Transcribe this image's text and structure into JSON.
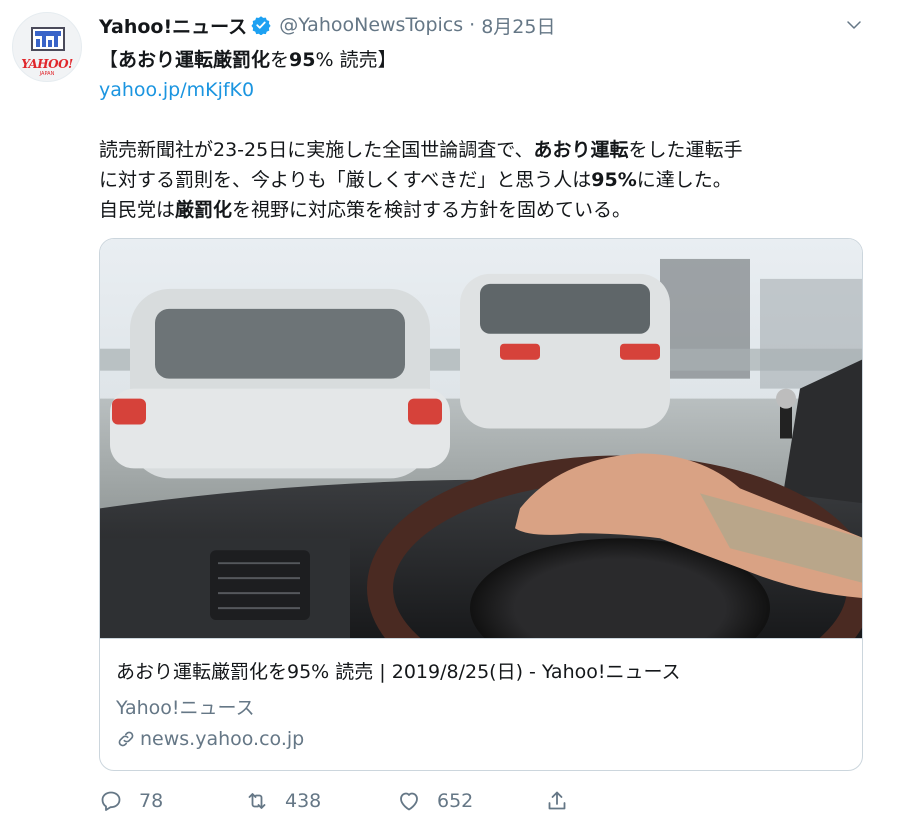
{
  "tweet": {
    "display_name": "Yahoo!ニュース",
    "handle": "@YahooNewsTopics",
    "separator": "·",
    "date": "8月25日",
    "avatar": {
      "icon": "yahoo-news-logo",
      "logo_text": "YAHOO!",
      "logo_subtext": "JAPAN"
    },
    "verified_icon": "verified-badge-icon",
    "headline": {
      "open_bracket": "【",
      "bold1": "あおり運転厳罰化",
      "plain1": "を",
      "bold2": "95",
      "plain2": "% 読売】"
    },
    "short_link": "yahoo.jp/mKjfK0",
    "body": {
      "line1_a": "読売新聞社が23-25日に実施した全国世論調査で、",
      "line1_b": "あおり運転",
      "line1_c": "をした運転手",
      "line2_a": "に対する罰則を、今よりも「厳しくすべきだ」と思う人は",
      "line2_b": "95%",
      "line2_c": "に達した。",
      "line3_a": "自民党は",
      "line3_b": "厳罰化",
      "line3_c": "を視野に対応策を検討する方針を固めている。"
    },
    "card": {
      "image": "car-driver-steering-wheel-photo",
      "title": "あおり運転厳罰化を95% 読売 | 2019/8/25(日) - Yahoo!ニュース",
      "source": "Yahoo!ニュース",
      "domain": "news.yahoo.co.jp",
      "domain_icon": "link-icon"
    },
    "actions": {
      "reply_count": "78",
      "retweet_count": "438",
      "like_count": "652",
      "reply_icon": "reply-icon",
      "retweet_icon": "retweet-icon",
      "like_icon": "heart-icon",
      "share_icon": "share-icon"
    },
    "colors": {
      "link": "#1b95e0",
      "secondary_text": "#657786",
      "verified": "#1da1f2",
      "border": "#ccd6dd"
    }
  }
}
